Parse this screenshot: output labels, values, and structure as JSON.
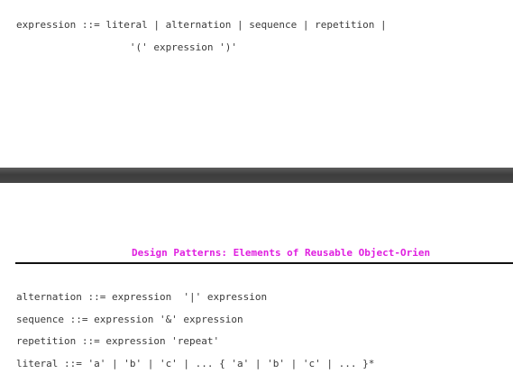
{
  "top_page": {
    "code_lines": [
      "expression ::= literal | alternation | sequence | repetition |",
      "                   '(' expression ')'"
    ]
  },
  "bottom_page": {
    "running_header": "Design Patterns: Elements of Reusable Object-Orien",
    "code_lines": [
      "alternation ::= expression  '|' expression",
      "sequence ::= expression '&' expression",
      "repetition ::= expression 'repeat'",
      "literal ::= 'a' | 'b' | 'c' | ... { 'a' | 'b' | 'c' | ... }*"
    ]
  },
  "colors": {
    "header_text": "#e020e0",
    "page_divider": "#454545"
  }
}
